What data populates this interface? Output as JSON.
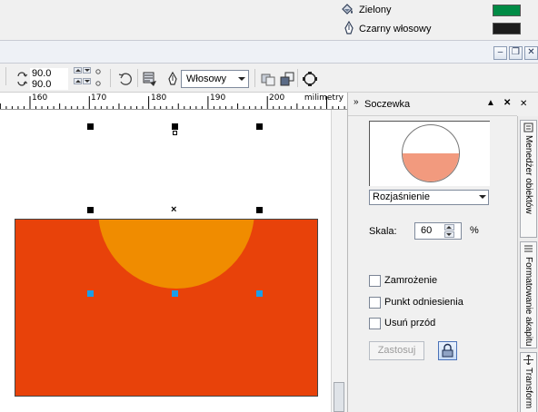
{
  "status": {
    "fill": {
      "label": "Zielony",
      "icon": "fill-bucket-icon",
      "color": "#008b45"
    },
    "outline": {
      "label": "Czarny włosowy",
      "icon": "pen-nib-icon",
      "color": "#1c1c1c"
    }
  },
  "window_controls": {
    "minimize": "–",
    "restore": "❐",
    "close": "✕"
  },
  "propbar": {
    "scale_x": "90.0",
    "scale_y": "90.0",
    "outline_width": "Włosowy"
  },
  "ruler": {
    "ticks": [
      "160",
      "170",
      "180",
      "190",
      "200"
    ],
    "unit": "milimetry"
  },
  "docker": {
    "title": "Soczewka",
    "lens_type": "Rozjaśnienie",
    "scale_label": "Skala:",
    "scale_value": "60",
    "scale_unit": "%",
    "checkboxes": {
      "freeze": "Zamrożenie",
      "viewpoint": "Punkt odniesienia",
      "remove_face": "Usuń przód"
    },
    "apply_label": "Zastosuj",
    "side_tabs": {
      "object_manager": "Menedżer obiektów",
      "paragraph_format": "Formatowanie akapitu",
      "transform": "Transform"
    },
    "colors": {
      "preview_fill": "#f29a7e"
    }
  },
  "canvas": {
    "colors": {
      "rectangle": "#e8420a",
      "circle": "#f08c00",
      "node_handle": "#1a9ee8"
    }
  }
}
